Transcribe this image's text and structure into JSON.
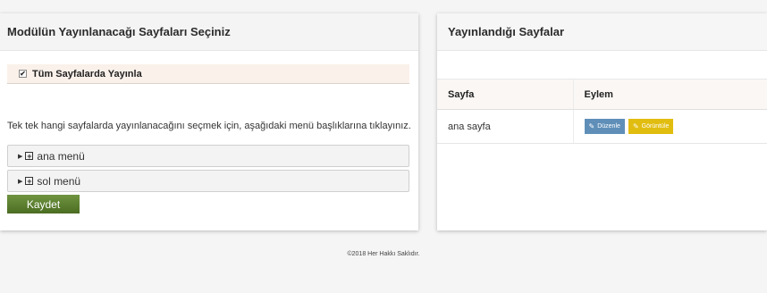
{
  "left_panel": {
    "title": "Modülün Yayınlanacağı Sayfaları Seçiniz",
    "all_pages_label": "Tüm Sayfalarda Yayınla",
    "all_pages_checked": true,
    "instruction": "Tek tek hangi sayfalarda yayınlanacağını seçmek için, aşağıdaki menü başlıklarına tıklayınız.",
    "menus": [
      {
        "label": "ana menü"
      },
      {
        "label": "sol menü"
      }
    ],
    "save_label": "Kaydet"
  },
  "right_panel": {
    "title": "Yayınlandığı Sayfalar",
    "columns": [
      "Sayfa",
      "Eylem"
    ],
    "rows": [
      {
        "page": "ana sayfa",
        "edit_label": "Düzenle",
        "view_label": "Görüntüle"
      }
    ]
  },
  "footer": "©2018 Her Hakkı Saklıdır.",
  "colors": {
    "save_button": "#5a7f2f",
    "edit_button": "#5f8fb8",
    "view_button": "#e1bd10"
  },
  "icons": {
    "checkbox": "checkbox-checked-icon",
    "expand": "triangle-right-icon",
    "plus": "plus-square-icon",
    "edit": "edit-icon"
  }
}
